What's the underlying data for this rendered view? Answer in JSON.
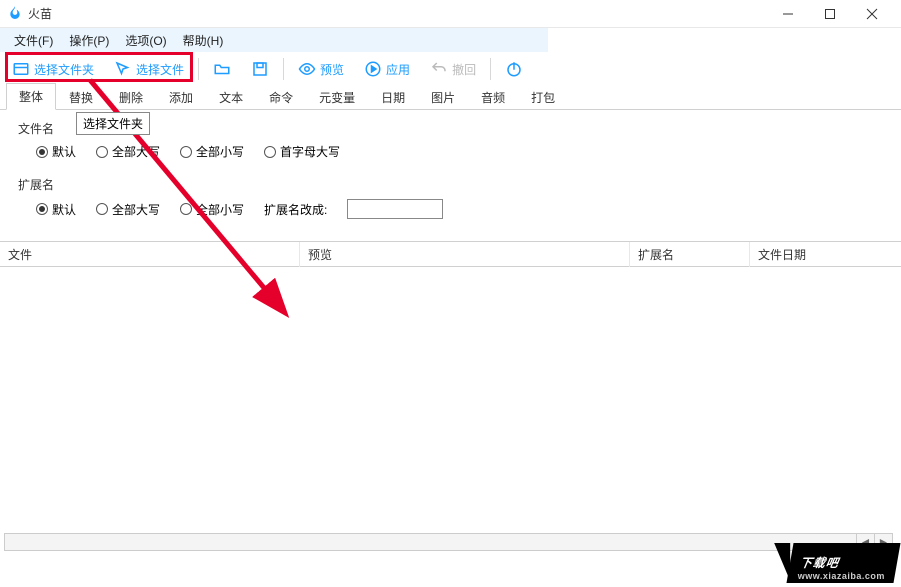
{
  "window": {
    "title": "火苗",
    "minimize": "—",
    "maximize": "□",
    "close": "✕"
  },
  "menu": {
    "file": "文件(F)",
    "operate": "操作(P)",
    "options": "选项(O)",
    "help": "帮助(H)"
  },
  "toolbar": {
    "select_folder": "选择文件夹",
    "select_file": "选择文件",
    "preview": "预览",
    "apply": "应用",
    "undo": "撤回"
  },
  "tabs": {
    "whole": "整体",
    "replace": "替换",
    "delete": "删除",
    "add": "添加",
    "text": "文本",
    "command": "命令",
    "metavar": "元变量",
    "date": "日期",
    "image": "图片",
    "audio": "音频",
    "pack": "打包"
  },
  "tooltip": {
    "text": "选择文件夹"
  },
  "filename_group": {
    "title": "文件名",
    "default": "默认",
    "upper": "全部大写",
    "lower": "全部小写",
    "cap": "首字母大写"
  },
  "ext_group": {
    "title": "扩展名",
    "default": "默认",
    "upper": "全部大写",
    "lower": "全部小写",
    "change_to": "扩展名改成:"
  },
  "table": {
    "col_file": "文件",
    "col_preview": "预览",
    "col_ext": "扩展名",
    "col_date": "文件日期"
  },
  "watermark": {
    "brand": "下载吧",
    "url": "www.xiazaiba.com"
  }
}
